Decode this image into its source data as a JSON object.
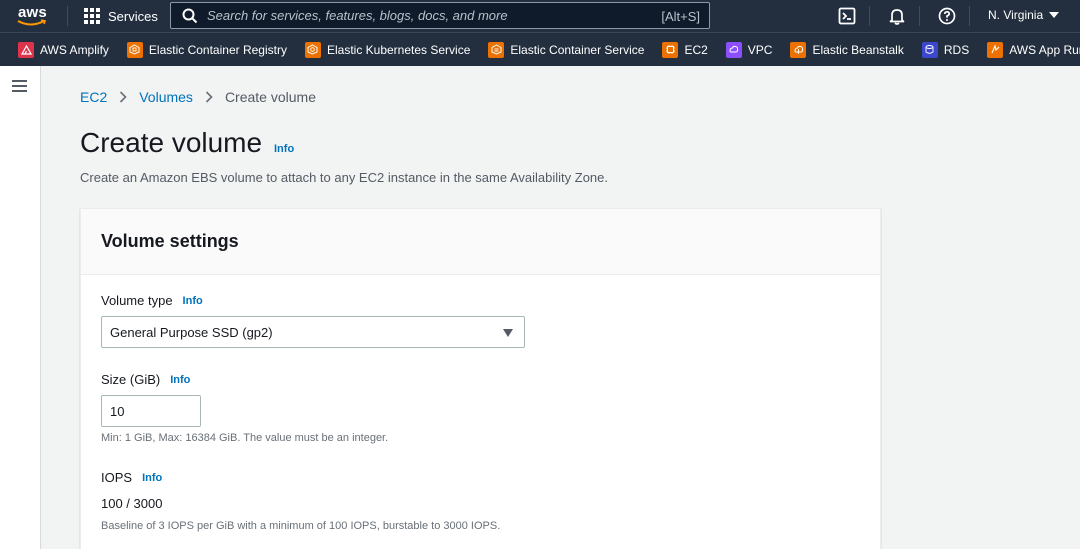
{
  "topnav": {
    "logo_text": "aws",
    "services_label": "Services",
    "search_placeholder": "Search for services, features, blogs, docs, and more",
    "search_shortcut": "[Alt+S]",
    "region_label": "N. Virginia"
  },
  "favorites": [
    {
      "label": "AWS Amplify",
      "color": "#dd344c",
      "icon": "amplify-icon"
    },
    {
      "label": "Elastic Container Registry",
      "color": "#ed7100",
      "icon": "ecr-icon"
    },
    {
      "label": "Elastic Kubernetes Service",
      "color": "#ed7100",
      "icon": "eks-icon"
    },
    {
      "label": "Elastic Container Service",
      "color": "#ed7100",
      "icon": "ecs-icon"
    },
    {
      "label": "EC2",
      "color": "#ed7100",
      "icon": "ec2-icon"
    },
    {
      "label": "VPC",
      "color": "#8c4fff",
      "icon": "vpc-icon"
    },
    {
      "label": "Elastic Beanstalk",
      "color": "#ed7100",
      "icon": "beanstalk-icon"
    },
    {
      "label": "RDS",
      "color": "#3b48cc",
      "icon": "rds-icon"
    },
    {
      "label": "AWS App Runner",
      "color": "#ed7100",
      "icon": "apprunner-icon"
    }
  ],
  "breadcrumb": {
    "items": [
      "EC2",
      "Volumes"
    ],
    "current": "Create volume"
  },
  "page": {
    "title": "Create volume",
    "info": "Info",
    "description": "Create an Amazon EBS volume to attach to any EC2 instance in the same Availability Zone."
  },
  "volume_settings": {
    "title": "Volume settings",
    "volume_type_label": "Volume type",
    "volume_type_info": "Info",
    "volume_type_value": "General Purpose SSD (gp2)",
    "size_label": "Size (GiB)",
    "size_info": "Info",
    "size_value": "10",
    "size_hint": "Min: 1 GiB, Max: 16384 GiB. The value must be an integer.",
    "iops_label": "IOPS",
    "iops_info": "Info",
    "iops_value": "100 / 3000",
    "iops_hint": "Baseline of 3 IOPS per GiB with a minimum of 100 IOPS, burstable to 3000 IOPS."
  },
  "colors": {
    "nav_bg": "#232f3e",
    "link": "#0073bb",
    "page_bg": "#f2f3f3"
  }
}
